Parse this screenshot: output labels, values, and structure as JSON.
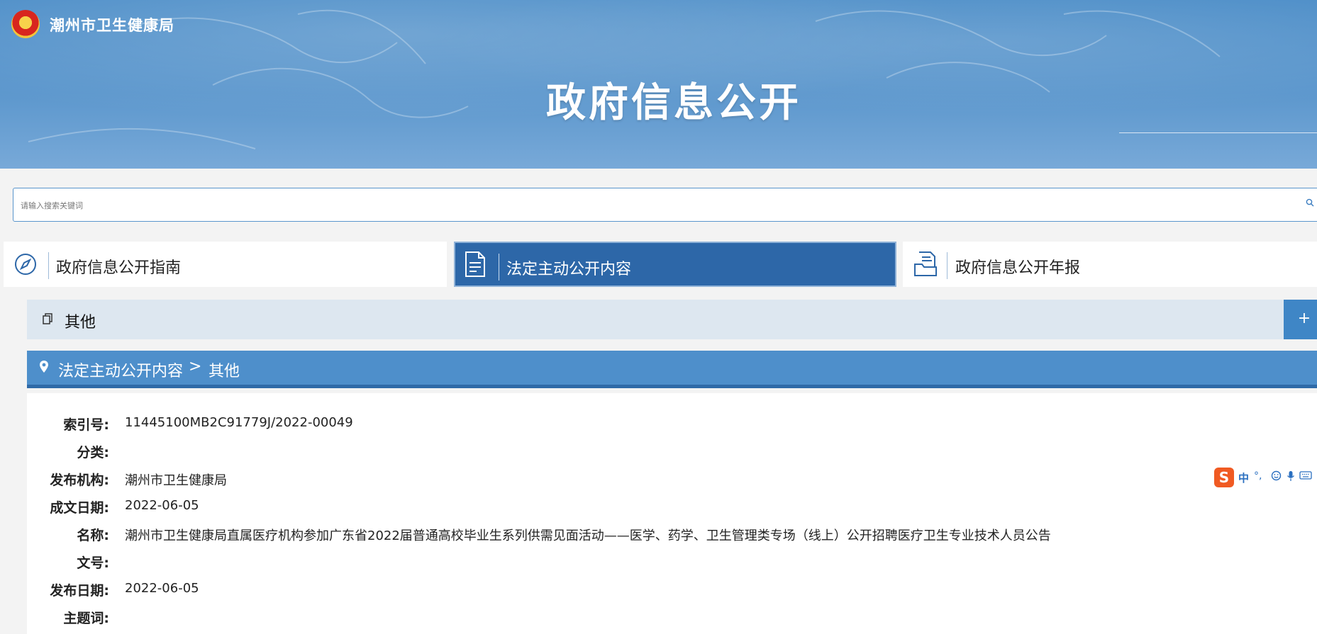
{
  "header": {
    "site_name": "潮州市卫生健康局",
    "banner_title": "政府信息公开"
  },
  "search": {
    "placeholder": "请输入搜索关键词"
  },
  "tabs": [
    {
      "label": "政府信息公开指南",
      "icon": "compass-icon",
      "active": false
    },
    {
      "label": "法定主动公开内容",
      "icon": "document-list-icon",
      "active": true
    },
    {
      "label": "政府信息公开年报",
      "icon": "folder-report-icon",
      "active": false
    }
  ],
  "accordion": {
    "label": "其他",
    "expand_symbol": "+"
  },
  "breadcrumb": {
    "items": [
      "法定主动公开内容",
      "其他"
    ],
    "separator": ">"
  },
  "details": [
    {
      "key": "索引号:",
      "value": "11445100MB2C91779J/2022-00049"
    },
    {
      "key": "分类:",
      "value": ""
    },
    {
      "key": "发布机构:",
      "value": "潮州市卫生健康局"
    },
    {
      "key": "成文日期:",
      "value": "2022-06-05"
    },
    {
      "key": "名称:",
      "value": "潮州市卫生健康局直属医疗机构参加广东省2022届普通高校毕业生系列供需见面活动——医学、药学、卫生管理类专场（线上）公开招聘医疗卫生专业技术人员公告"
    },
    {
      "key": "文号:",
      "value": ""
    },
    {
      "key": "发布日期:",
      "value": "2022-06-05"
    },
    {
      "key": "主题词:",
      "value": ""
    }
  ],
  "ime_toolbar": {
    "logo": "S",
    "mode": "中",
    "punct": "°,",
    "icons": [
      "smiley-icon",
      "microphone-icon",
      "keyboard-icon"
    ]
  },
  "colors": {
    "banner": "#5c97cd",
    "active_tab": "#2d67a8",
    "breadcrumb": "#4e8fcb",
    "accordion": "#dde7f0"
  }
}
